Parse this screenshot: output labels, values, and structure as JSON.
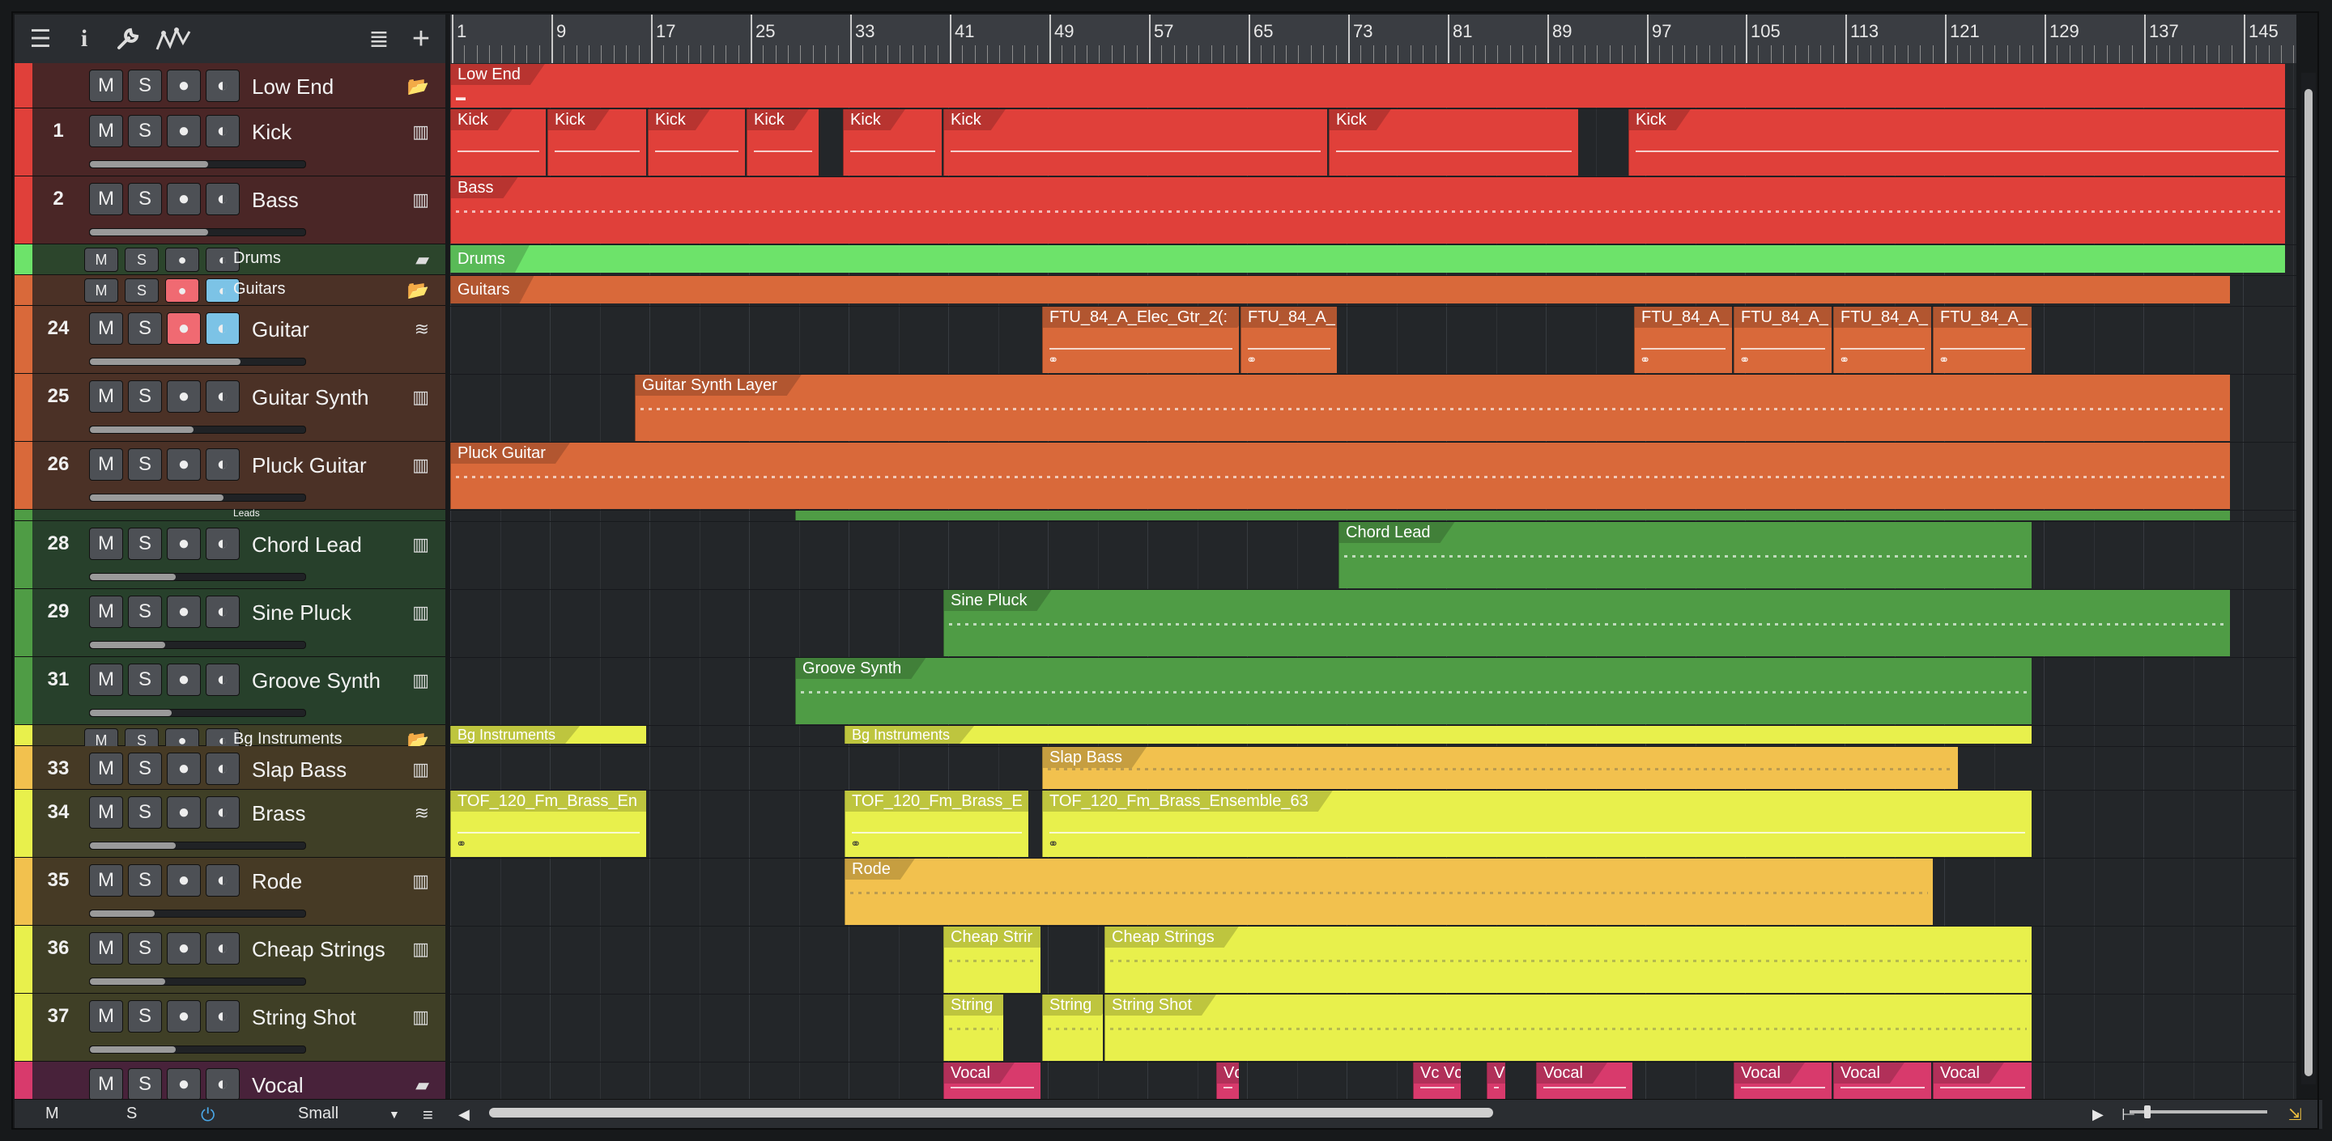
{
  "toolbar": {
    "icons": [
      "menu-icon",
      "info-icon",
      "wrench-icon",
      "automation-icon",
      "list-icon",
      "add-icon"
    ],
    "glyphs": [
      "☰",
      "i",
      "🔧",
      "∿",
      "≣",
      "+"
    ]
  },
  "ruler": {
    "bars": [
      "1",
      "9",
      "17",
      "25",
      "33",
      "41",
      "49",
      "57",
      "65",
      "73",
      "81",
      "89",
      "97",
      "105",
      "113",
      "121",
      "129",
      "137",
      "145"
    ]
  },
  "buttons": {
    "mute": "M",
    "solo": "S",
    "record": "●",
    "monitor": "◐"
  },
  "tracks": [
    {
      "num": "",
      "name": "Low End",
      "color": "#e0403a",
      "tint": "#4a2626",
      "h": 56,
      "folder": true,
      "icon": "📂"
    },
    {
      "num": "1",
      "name": "Kick",
      "color": "#e0403a",
      "tint": "#4a2626",
      "h": 84,
      "fader": 0.55,
      "icon": "▥"
    },
    {
      "num": "2",
      "name": "Bass",
      "color": "#e0403a",
      "tint": "#4a2626",
      "h": 84,
      "fader": 0.55,
      "icon": "▥"
    },
    {
      "num": "",
      "name": "Drums",
      "color": "#6de36a",
      "tint": "#2c452c",
      "h": 38,
      "folder": true,
      "small": true,
      "icon": "▰"
    },
    {
      "num": "",
      "name": "Guitars",
      "color": "#d9693a",
      "tint": "#4b3126",
      "h": 38,
      "folder": true,
      "small": true,
      "rec": true,
      "mon": true,
      "icon": "📂"
    },
    {
      "num": "24",
      "name": "Guitar",
      "color": "#d9693a",
      "tint": "#4b3126",
      "h": 84,
      "fader": 0.7,
      "rec": true,
      "mon": true,
      "icon": "≋"
    },
    {
      "num": "25",
      "name": "Guitar Synth",
      "color": "#d9693a",
      "tint": "#4b3126",
      "h": 84,
      "fader": 0.48,
      "icon": "▥"
    },
    {
      "num": "26",
      "name": "Pluck Guitar",
      "color": "#d9693a",
      "tint": "#4b3126",
      "h": 84,
      "fader": 0.62,
      "icon": "▥"
    },
    {
      "num": "",
      "name": "Leads",
      "color": "#4f9c45",
      "tint": "#27402b",
      "h": 14,
      "folder": true,
      "tiny": true
    },
    {
      "num": "28",
      "name": "Chord Lead",
      "color": "#4f9c45",
      "tint": "#27402b",
      "h": 84,
      "fader": 0.4,
      "icon": "▥"
    },
    {
      "num": "29",
      "name": "Sine Pluck",
      "color": "#4f9c45",
      "tint": "#27402b",
      "h": 84,
      "fader": 0.35,
      "icon": "▥"
    },
    {
      "num": "31",
      "name": "Groove Synth",
      "color": "#4f9c45",
      "tint": "#27402b",
      "h": 84,
      "fader": 0.38,
      "icon": "▥"
    },
    {
      "num": "",
      "name": "Bg Instruments",
      "color": "#e8f04c",
      "tint": "#3f3f26",
      "h": 26,
      "folder": true,
      "small": true,
      "icon": "📂"
    },
    {
      "num": "33",
      "name": "Slap Bass",
      "color": "#f2c14e",
      "tint": "#463a25",
      "h": 54,
      "icon": "▥"
    },
    {
      "num": "34",
      "name": "Brass",
      "color": "#e8f04c",
      "tint": "#3f3f26",
      "h": 84,
      "fader": 0.4,
      "icon": "≋"
    },
    {
      "num": "35",
      "name": "Rode",
      "color": "#f2c14e",
      "tint": "#463a25",
      "h": 84,
      "fader": 0.3,
      "icon": "▥"
    },
    {
      "num": "36",
      "name": "Cheap Strings",
      "color": "#e8f04c",
      "tint": "#3f3f26",
      "h": 84,
      "fader": 0.35,
      "icon": "▥"
    },
    {
      "num": "37",
      "name": "String Shot",
      "color": "#e8f04c",
      "tint": "#3f3f26",
      "h": 84,
      "fader": 0.4,
      "icon": "▥"
    },
    {
      "num": "",
      "name": "Vocal",
      "color": "#d83a6c",
      "tint": "#48223a",
      "h": 50,
      "folder": true,
      "icon": "▰"
    }
  ],
  "clips": [
    {
      "track": 0,
      "segs": [
        [
          0,
          2268
        ]
      ],
      "label": "Low End",
      "color": "#e0403a",
      "kind": "folder"
    },
    {
      "track": 1,
      "segs": [
        [
          0,
          120
        ],
        [
          120,
          244
        ],
        [
          244,
          366
        ],
        [
          366,
          457
        ],
        [
          485,
          609
        ],
        [
          609,
          1085
        ]
      ],
      "label": "Kick",
      "color": "#e0403a",
      "kind": "audio"
    },
    {
      "track": 1,
      "segs": [
        [
          1085,
          1395
        ]
      ],
      "label": "Kick",
      "color": "#e0403a",
      "kind": "audio"
    },
    {
      "track": 1,
      "segs": [
        [
          1455,
          2268
        ]
      ],
      "label": "Kick",
      "color": "#e0403a",
      "kind": "audio"
    },
    {
      "track": 2,
      "segs": [
        [
          0,
          2268
        ]
      ],
      "label": "Bass",
      "color": "#e0403a",
      "kind": "midi"
    },
    {
      "track": 3,
      "segs": [
        [
          0,
          2268
        ]
      ],
      "label": "Drums",
      "color": "#6de36a",
      "kind": "folder-thin"
    },
    {
      "track": 4,
      "segs": [
        [
          0,
          2200
        ]
      ],
      "label": "Guitars",
      "color": "#d9693a",
      "kind": "folder-thin"
    },
    {
      "track": 5,
      "segs": [
        [
          731,
          976
        ],
        [
          976,
          1097
        ],
        [
          1462,
          1585
        ],
        [
          1585,
          1708
        ],
        [
          1708,
          1831
        ],
        [
          1831,
          1955
        ]
      ],
      "label": "FTU_84_A_Elec_Gtr_2(:",
      "labels2": [
        "FTU_84_A_Elec_Gtr_2(:",
        "FTU_84_A_",
        "FTU_84_A_",
        "FTU_84_A_",
        "FTU_84_A_",
        "FTU_84_A_"
      ],
      "color": "#d9693a",
      "kind": "audio-link"
    },
    {
      "track": 6,
      "segs": [
        [
          228,
          2200
        ]
      ],
      "label": "Guitar Synth Layer",
      "color": "#d9693a",
      "kind": "midi"
    },
    {
      "track": 7,
      "segs": [
        [
          0,
          2200
        ]
      ],
      "label": "Pluck Guitar",
      "color": "#d9693a",
      "kind": "midi"
    },
    {
      "track": 8,
      "segs": [
        [
          426,
          2200
        ]
      ],
      "label": "",
      "color": "#4f9c45",
      "kind": "folder-thin"
    },
    {
      "track": 9,
      "segs": [
        [
          1097,
          1955
        ]
      ],
      "label": "Chord Lead",
      "color": "#4f9c45",
      "kind": "midi"
    },
    {
      "track": 10,
      "segs": [
        [
          609,
          2200
        ]
      ],
      "label": "Sine Pluck",
      "color": "#4f9c45",
      "kind": "midi"
    },
    {
      "track": 11,
      "segs": [
        [
          426,
          1955
        ]
      ],
      "label": "Groove Synth",
      "color": "#4f9c45",
      "kind": "midi"
    },
    {
      "track": 12,
      "segs": [
        [
          0,
          244
        ],
        [
          487,
          1955
        ]
      ],
      "label": "Bg Instruments",
      "color": "#e8f04c",
      "kind": "folder-thin"
    },
    {
      "track": 13,
      "segs": [
        [
          731,
          1864
        ]
      ],
      "label": "Slap Bass",
      "color": "#f2c14e",
      "kind": "midi"
    },
    {
      "track": 14,
      "segs": [
        [
          0,
          244
        ],
        [
          487,
          716
        ],
        [
          731,
          1955
        ]
      ],
      "label": "TOF_120_Fm_Brass_Ensemble_63",
      "labels2": [
        "TOF_120_Fm_Brass_En",
        "TOF_120_Fm_Brass_E",
        "TOF_120_Fm_Brass_Ensemble_63"
      ],
      "color": "#e8f04c",
      "kind": "audio-link"
    },
    {
      "track": 15,
      "segs": [
        [
          487,
          1833
        ]
      ],
      "label": "Rode",
      "color": "#f2c14e",
      "kind": "midi"
    },
    {
      "track": 16,
      "segs": [
        [
          609,
          731
        ],
        [
          808,
          1955
        ]
      ],
      "label": "Cheap Strings",
      "labels2": [
        "Cheap Strir",
        "Cheap Strings"
      ],
      "color": "#e8f04c",
      "kind": "midi"
    },
    {
      "track": 17,
      "segs": [
        [
          609,
          685
        ],
        [
          731,
          808
        ],
        [
          808,
          1955
        ]
      ],
      "label": "String Shot",
      "labels2": [
        "String",
        "String",
        "String Shot"
      ],
      "color": "#e8f04c",
      "kind": "midi"
    },
    {
      "track": 18,
      "segs": [
        [
          609,
          731
        ],
        [
          946,
          976
        ],
        [
          1189,
          1250
        ],
        [
          1280,
          1305
        ],
        [
          1341,
          1462
        ],
        [
          1585,
          1708
        ],
        [
          1708,
          1831
        ],
        [
          1831,
          1955
        ]
      ],
      "label": "Vocal",
      "labels2": [
        "Vocal",
        "Vc",
        "Vc Vc",
        "Vc",
        "Vocal",
        "Vocal",
        "Vocal",
        "Vocal"
      ],
      "color": "#d83a6c",
      "kind": "audio"
    }
  ],
  "bottombar": {
    "mute": "M",
    "solo": "S",
    "size": "Small"
  }
}
